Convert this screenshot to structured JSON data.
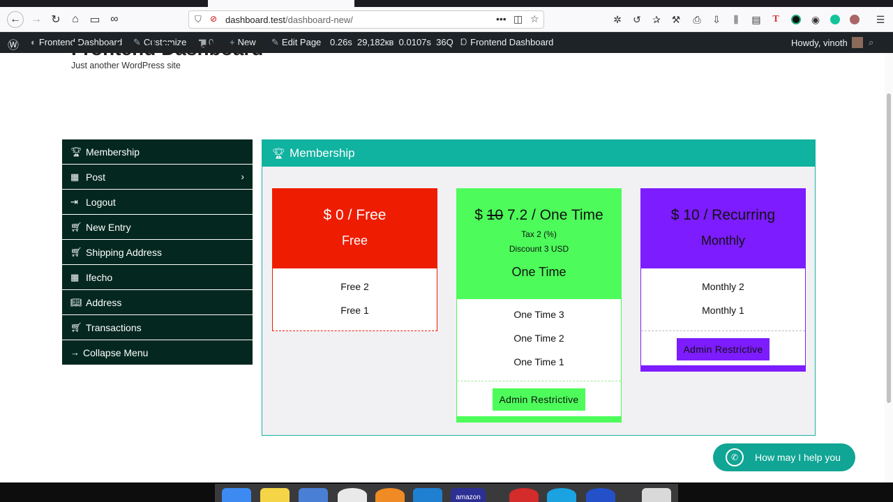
{
  "browser": {
    "url_host": "dashboard.test",
    "url_path": "/dashboard-new/"
  },
  "adminbar": {
    "site": "Frontend Dashboard",
    "customize": "Customize",
    "comments": "0",
    "new": "New",
    "edit_page": "Edit Page",
    "time": "0.26s",
    "memory": "29,182кв",
    "query_time": "0.0107s",
    "queries": "36Q",
    "plugin": "Frontend Dashboard",
    "howdy": "Howdy, vinoth"
  },
  "site": {
    "title": "Frontend Dashboard",
    "tagline": "Just another WordPress site"
  },
  "sidebar": {
    "items": [
      {
        "label": "Membership",
        "icon": "trophy-icon"
      },
      {
        "label": "Post",
        "icon": "calendar-icon"
      },
      {
        "label": "Logout",
        "icon": "sign-out-icon"
      },
      {
        "label": "New Entry",
        "icon": "cart-icon"
      },
      {
        "label": "Shipping Address",
        "icon": "cart-icon"
      },
      {
        "label": "Ifecho",
        "icon": "calendar-icon"
      },
      {
        "label": "Address",
        "icon": "book-icon"
      },
      {
        "label": "Transactions",
        "icon": "cart-icon"
      },
      {
        "label": "Collapse Menu",
        "icon": "arrow-right-icon"
      }
    ]
  },
  "panel": {
    "title": "Membership",
    "plans": [
      {
        "price": "$ 0 / Free",
        "name": "Free",
        "color": "#ee1c00",
        "features": [
          "Free 2",
          "Free 1"
        ]
      },
      {
        "price_prefix": "$",
        "price_old": "10",
        "price_rest": "7.2 / One Time",
        "tax": "Tax 2 (%)",
        "discount": "Discount 3 USD",
        "name": "One Time",
        "color": "#4dfc5a",
        "features": [
          "One Time 3",
          "One Time 2",
          "One Time 1"
        ],
        "button": "Admin Restrictive"
      },
      {
        "price": "$ 10 / Recurring",
        "name": "Monthly",
        "color": "#7d1cff",
        "features": [
          "Monthly 2",
          "Monthly 1"
        ],
        "button": "Admin Restrictive"
      }
    ]
  },
  "whatsapp": {
    "label": "How may I help you"
  },
  "dock": {
    "amazon": "amazon"
  }
}
